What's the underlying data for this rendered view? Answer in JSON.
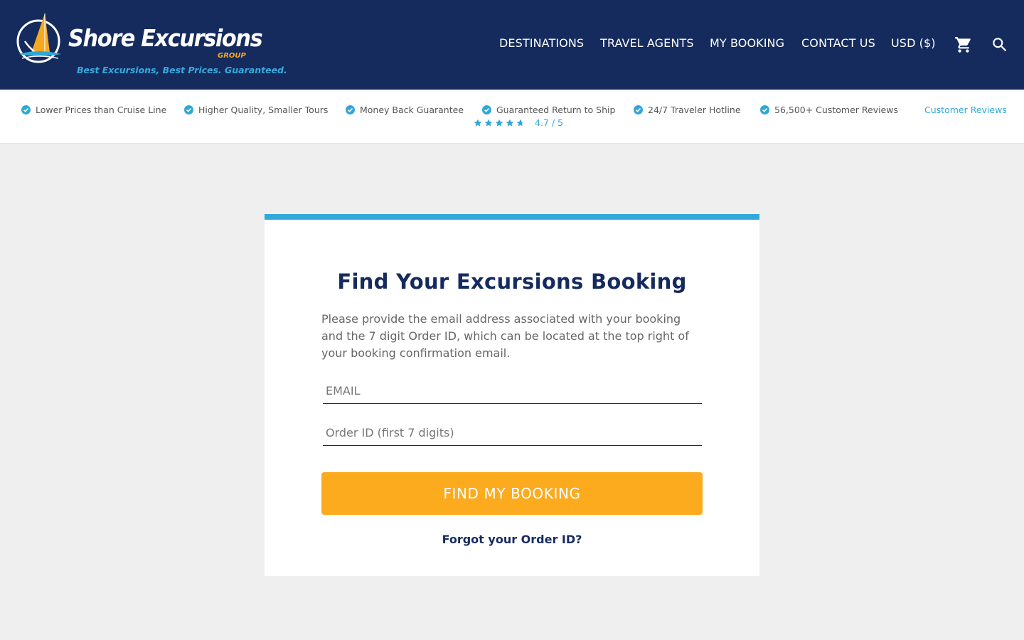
{
  "header": {
    "brand_name": "Shore Excursions",
    "brand_group": "GROUP",
    "tagline": "Best Excursions, Best Prices. Guaranteed.",
    "nav": [
      {
        "label": "DESTINATIONS"
      },
      {
        "label": "TRAVEL AGENTS"
      },
      {
        "label": "MY BOOKING"
      },
      {
        "label": "CONTACT US"
      },
      {
        "label": "USD ($)"
      }
    ],
    "icons": {
      "cart": "cart-icon",
      "search": "search-icon"
    }
  },
  "trust_bar": {
    "items": [
      {
        "label": "Lower Prices than Cruise Line"
      },
      {
        "label": "Higher Quality, Smaller Tours"
      },
      {
        "label": "Money Back Guarantee"
      },
      {
        "label": "Guaranteed Return to Ship"
      },
      {
        "label": "24/7 Traveler Hotline"
      },
      {
        "label": "56,500+ Customer Reviews"
      }
    ],
    "reviews_link": "Customer Reviews",
    "rating_text": "4.7 / 5",
    "rating_value": 4.7,
    "rating_max": 5
  },
  "booking": {
    "title": "Find Your Excursions Booking",
    "description": "Please provide the email address associated with your booking and the 7 digit Order ID, which can be located at the top right of your booking confirmation email.",
    "email_placeholder": "EMAIL",
    "email_value": "",
    "order_placeholder": "Order ID (first 7 digits)",
    "order_value": "",
    "submit_label": "FIND MY BOOKING",
    "forgot_label": "Forgot your Order ID?"
  },
  "colors": {
    "header_bg": "#152b5e",
    "accent_blue": "#34a9d9",
    "accent_orange": "#fcab1f",
    "page_bg": "#efefef",
    "check_blue": "#2fa8d8"
  }
}
